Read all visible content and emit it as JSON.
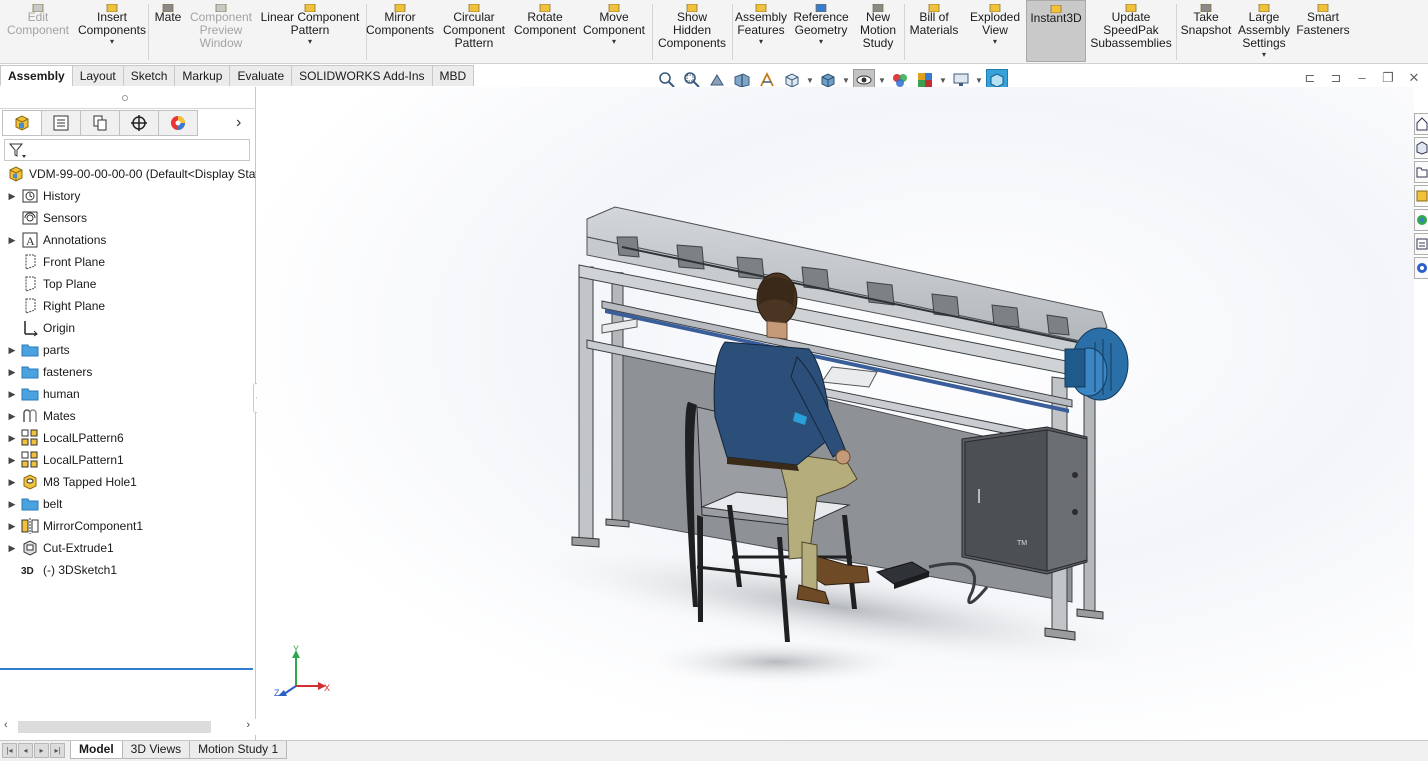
{
  "ribbon": {
    "buttons": [
      {
        "label": "Edit\nComponent",
        "icon": "edit-component-icon",
        "disabled": true,
        "dropdown": false
      },
      {
        "label": "Insert\nComponents",
        "icon": "insert-components-icon",
        "disabled": false,
        "dropdown": true
      },
      {
        "label": "Mate",
        "icon": "mate-icon",
        "disabled": false,
        "dropdown": false
      },
      {
        "label": "Component\nPreview\nWindow",
        "icon": "component-preview-icon",
        "disabled": true,
        "dropdown": false
      },
      {
        "label": "Linear Component\nPattern",
        "icon": "linear-pattern-icon",
        "disabled": false,
        "dropdown": true
      },
      {
        "label": "Mirror\nComponents",
        "icon": "mirror-components-icon",
        "disabled": false,
        "dropdown": false
      },
      {
        "label": "Circular\nComponent\nPattern",
        "icon": "circular-pattern-icon",
        "disabled": false,
        "dropdown": false
      },
      {
        "label": "Rotate\nComponent",
        "icon": "rotate-component-icon",
        "disabled": false,
        "dropdown": false
      },
      {
        "label": "Move\nComponent",
        "icon": "move-component-icon",
        "disabled": false,
        "dropdown": true
      },
      {
        "label": "Show\nHidden\nComponents",
        "icon": "show-hidden-icon",
        "disabled": false,
        "dropdown": false
      },
      {
        "label": "Assembly\nFeatures",
        "icon": "assembly-features-icon",
        "disabled": false,
        "dropdown": true
      },
      {
        "label": "Reference\nGeometry",
        "icon": "reference-geometry-icon",
        "disabled": false,
        "dropdown": true
      },
      {
        "label": "New\nMotion\nStudy",
        "icon": "motion-study-icon",
        "disabled": false,
        "dropdown": false
      },
      {
        "label": "Bill of\nMaterials",
        "icon": "bill-of-materials-icon",
        "disabled": false,
        "dropdown": false
      },
      {
        "label": "Exploded\nView",
        "icon": "exploded-view-icon",
        "disabled": false,
        "dropdown": true
      },
      {
        "label": "Instant3D",
        "icon": "instant3d-icon",
        "disabled": false,
        "dropdown": false,
        "active": true
      },
      {
        "label": "Update\nSpeedPak\nSubassemblies",
        "icon": "speedpak-icon",
        "disabled": false,
        "dropdown": false
      },
      {
        "label": "Take\nSnapshot",
        "icon": "snapshot-icon",
        "disabled": false,
        "dropdown": false
      },
      {
        "label": "Large\nAssembly\nSettings",
        "icon": "large-assembly-icon",
        "disabled": false,
        "dropdown": true
      },
      {
        "label": "Smart\nFasteners",
        "icon": "smart-fasteners-icon",
        "disabled": false,
        "dropdown": false
      }
    ]
  },
  "tabs": [
    "Assembly",
    "Layout",
    "Sketch",
    "Markup",
    "Evaluate",
    "SOLIDWORKS Add-Ins",
    "MBD"
  ],
  "active_tab": "Assembly",
  "feature_tree": {
    "root": "VDM-99-00-00-00-00  (Default<Display Stat",
    "items": [
      {
        "label": "History",
        "icon": "history-icon",
        "expandable": true
      },
      {
        "label": "Sensors",
        "icon": "sensors-icon",
        "expandable": false
      },
      {
        "label": "Annotations",
        "icon": "annotations-icon",
        "expandable": true
      },
      {
        "label": "Front Plane",
        "icon": "plane-icon",
        "expandable": false
      },
      {
        "label": "Top Plane",
        "icon": "plane-icon",
        "expandable": false
      },
      {
        "label": "Right Plane",
        "icon": "plane-icon",
        "expandable": false
      },
      {
        "label": "Origin",
        "icon": "origin-icon",
        "expandable": false
      },
      {
        "label": "parts",
        "icon": "folder-icon",
        "expandable": true
      },
      {
        "label": "fasteners",
        "icon": "folder-icon",
        "expandable": true
      },
      {
        "label": "human",
        "icon": "folder-icon",
        "expandable": true
      },
      {
        "label": "Mates",
        "icon": "mates-icon",
        "expandable": true
      },
      {
        "label": "LocalLPattern6",
        "icon": "linear-pattern-icon",
        "expandable": true
      },
      {
        "label": "LocalLPattern1",
        "icon": "linear-pattern-icon",
        "expandable": true
      },
      {
        "label": "M8 Tapped Hole1",
        "icon": "tapped-hole-icon",
        "expandable": true
      },
      {
        "label": "belt",
        "icon": "folder-icon",
        "expandable": true
      },
      {
        "label": "MirrorComponent1",
        "icon": "mirror-component-icon",
        "expandable": true
      },
      {
        "label": "Cut-Extrude1",
        "icon": "cut-extrude-icon",
        "expandable": true
      },
      {
        "label": "(-) 3DSketch1",
        "icon": "3dsketch-icon",
        "expandable": false
      }
    ]
  },
  "bottom_tabs": [
    "Model",
    "3D Views",
    "Motion Study 1"
  ],
  "active_bottom_tab": "Model",
  "triad": {
    "x": "X",
    "y": "Y",
    "z": "Z"
  },
  "scene": {
    "cabinet_mark": "TM"
  },
  "colors": {
    "accent": "#2e7fd0",
    "instant3d_active": "#c9c9c9",
    "viewport_gradient_center": "#e9eef5"
  }
}
